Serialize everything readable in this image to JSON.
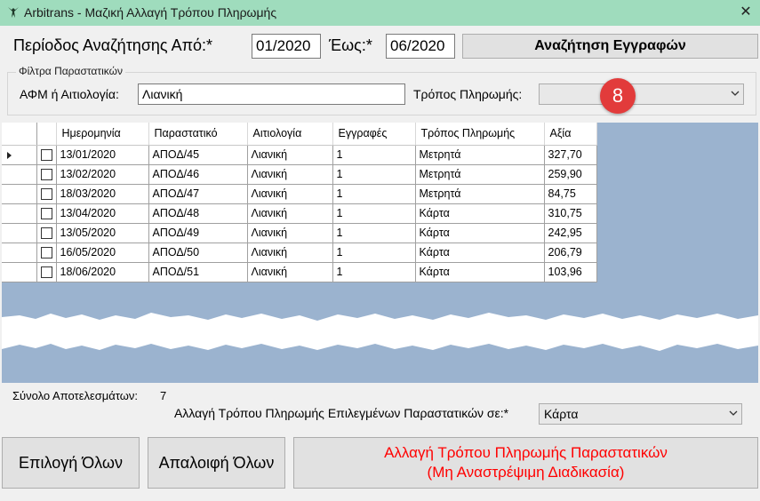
{
  "window": {
    "title": "Arbitrans - Μαζική Αλλαγή Τρόπου Πληρωμής",
    "close_symbol": "✕"
  },
  "period": {
    "from_label": "Περίοδος Αναζήτησης Από:*",
    "from_value": "01/2020",
    "to_label": "Έως:*",
    "to_value": "06/2020",
    "search_button": "Αναζήτηση Εγγραφών"
  },
  "filters": {
    "group_title": "Φίλτρα Παραστατικών",
    "afm_label": "ΑΦΜ ή Αιτιολογία:",
    "afm_value": "Λιανική",
    "payment_label": "Τρόπος Πληρωμής:",
    "payment_value": "",
    "badge": "8"
  },
  "grid": {
    "columns": [
      "Ημερομηνία",
      "Παραστατικό",
      "Αιτιολογία",
      "Εγγραφές",
      "Τρόπος Πληρωμής",
      "Αξία"
    ],
    "rows": [
      {
        "checked": false,
        "current": true,
        "date": "13/01/2020",
        "doc": "ΑΠΟΔ/45",
        "reason": "Λιανική",
        "entries": "1",
        "payment": "Μετρητά",
        "value": "327,70"
      },
      {
        "checked": false,
        "current": false,
        "date": "13/02/2020",
        "doc": "ΑΠΟΔ/46",
        "reason": "Λιανική",
        "entries": "1",
        "payment": "Μετρητά",
        "value": "259,90"
      },
      {
        "checked": false,
        "current": false,
        "date": "18/03/2020",
        "doc": "ΑΠΟΔ/47",
        "reason": "Λιανική",
        "entries": "1",
        "payment": "Μετρητά",
        "value": "84,75"
      },
      {
        "checked": false,
        "current": false,
        "date": "13/04/2020",
        "doc": "ΑΠΟΔ/48",
        "reason": "Λιανική",
        "entries": "1",
        "payment": "Κάρτα",
        "value": "310,75"
      },
      {
        "checked": false,
        "current": false,
        "date": "13/05/2020",
        "doc": "ΑΠΟΔ/49",
        "reason": "Λιανική",
        "entries": "1",
        "payment": "Κάρτα",
        "value": "242,95"
      },
      {
        "checked": false,
        "current": false,
        "date": "16/05/2020",
        "doc": "ΑΠΟΔ/50",
        "reason": "Λιανική",
        "entries": "1",
        "payment": "Κάρτα",
        "value": "206,79"
      },
      {
        "checked": false,
        "current": false,
        "date": "18/06/2020",
        "doc": "ΑΠΟΔ/51",
        "reason": "Λιανική",
        "entries": "1",
        "payment": "Κάρτα",
        "value": "103,96"
      }
    ]
  },
  "footer": {
    "total_label": "Σύνολο Αποτελεσμάτων:",
    "total_value": "7",
    "change_label": "Αλλαγή Τρόπου Πληρωμής Επιλεγμένων Παραστατικών σε:*",
    "change_value": "Κάρτα",
    "select_all": "Επιλογή Όλων",
    "clear_all": "Απαλοιφή Όλων",
    "apply_line1": "Αλλαγή Τρόπου Πληρωμής Παραστατικών",
    "apply_line2": "(Μη Αναστρέψιμη Διαδικασία)"
  },
  "icons": {
    "app": "eagle-logo-icon",
    "close": "close-icon",
    "dropdown": "chevron-down-icon",
    "row_pointer": "current-row-arrow-icon"
  },
  "colors": {
    "titlebar": "#9fdcbd",
    "grid_background": "#9bb3cf",
    "badge": "#e23b3b",
    "apply_text": "#ff0000"
  }
}
